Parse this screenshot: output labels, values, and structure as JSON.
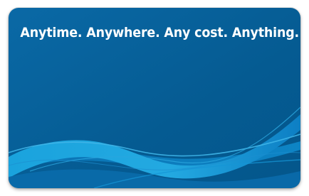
{
  "card": {
    "tagline": "Anytime. Anywhere. Any cost. Anything."
  },
  "colors": {
    "card_background": "#055b92",
    "card_background_light": "#0a69a6",
    "wave_primary": "#1aa3dd",
    "wave_secondary": "#0c7fc2",
    "wave_highlight": "#3fb5e8",
    "tagline": "#ffffff"
  },
  "icons": {
    "decoration": "wave-swoosh-graphic"
  }
}
